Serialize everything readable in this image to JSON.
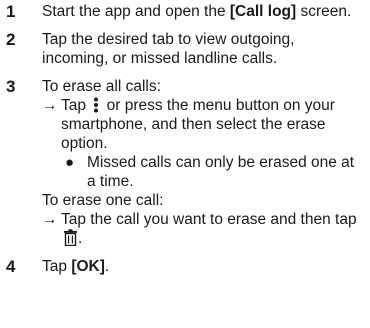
{
  "steps": [
    {
      "num": "1",
      "pre": "Start the app and open the ",
      "bold": "[Call log]",
      "post": " screen."
    },
    {
      "num": "2",
      "text": "Tap the desired tab to view outgoing, incoming, or missed landline calls."
    },
    {
      "num": "3",
      "erase_all_heading": "To erase all calls:",
      "arrow": "→",
      "erase_all_pre": "Tap",
      "erase_all_post": "or press the menu button on your smartphone, and then select the erase option.",
      "bullet": "●",
      "note": "Missed calls can only be erased one at a time.",
      "erase_one_heading": "To erase one call:",
      "erase_one_pre": "Tap the call you want to erase and then tap",
      "erase_one_post": "."
    },
    {
      "num": "4",
      "pre": "Tap ",
      "bold": "[OK]",
      "post": "."
    }
  ],
  "icons": {
    "menu": "kebab-menu-icon",
    "erase": "trash-icon"
  }
}
